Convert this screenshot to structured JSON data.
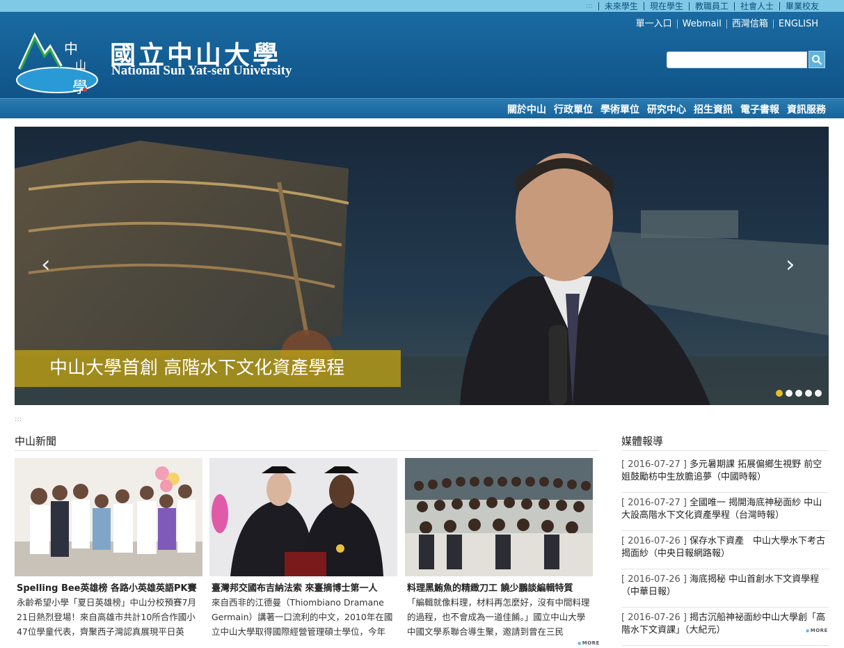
{
  "topbar": {
    "accesskey": ":::",
    "links": [
      "未來學生",
      "現在學生",
      "教職員工",
      "社會人士",
      "畢業校友"
    ]
  },
  "header": {
    "title_zh": "國立中山大學",
    "title_en": "National Sun Yat-sen University",
    "links": [
      "單一入口",
      "Webmail",
      "西灣信箱",
      "ENGLISH"
    ],
    "search": {
      "value": "",
      "placeholder": ""
    }
  },
  "nav": {
    "items": [
      "關於中山",
      "行政單位",
      "學術單位",
      "研究中心",
      "招生資訊",
      "電子書報",
      "資訊服務"
    ]
  },
  "banner": {
    "caption": "中山大學首創  高階水下文化資產學程",
    "slides": 5,
    "active_slide": 1,
    "prev": "‹",
    "next": "›"
  },
  "skip": ":::",
  "news": {
    "heading": "中山新聞",
    "more": "MORE",
    "items": [
      {
        "title": "Spelling Bee英雄榜 各路小英雄英語PK賽",
        "summary": "永齡希望小學「夏日英雄榜」中山分校預賽7月21日熱烈登場！來自高雄市共計10所合作國小47位學童代表，齊聚西子灣認真展現平日英"
      },
      {
        "title": "臺灣邦交國布吉納法索 來臺摘博士第一人",
        "summary": "來自西非的江德曼（Thiombiano Dramane Germain）講著一口流利的中文，2010年在國立中山大學取得國際經營管理碩士學位，今年"
      },
      {
        "title": "料理黑鮪魚的精緻刀工 饒少鵬談編輯特質",
        "summary": "「編輯就像料理，材料再怎麼好，沒有中間料理的過程，也不會成為一道佳餚。」國立中山大學中國文學系聯合導生聚，邀請到曾在三民"
      }
    ]
  },
  "media": {
    "heading": "媒體報導",
    "more": "MORE",
    "items": [
      {
        "date": "[ 2016-07-27 ]",
        "text": "多元暑期課 拓展偏鄉生視野 前空姐鼓勵枋中生放膽追夢（中國時報）"
      },
      {
        "date": "[ 2016-07-27 ]",
        "text": "全國唯一 揭開海底神秘面紗 中山大設高階水下文化資產學程（台灣時報）"
      },
      {
        "date": "[ 2016-07-26 ]",
        "text": "保存水下資產　中山大學水下考古揭面紗（中央日報網路報）"
      },
      {
        "date": "[ 2016-07-26 ]",
        "text": "海底揭秘 中山首創水下文資學程（中華日報）"
      },
      {
        "date": "[ 2016-07-26 ]",
        "text": "揭古沉船神祕面紗中山大學創「高階水下文資課」（大紀元）"
      }
    ]
  },
  "colors": {
    "topbar": "#7fc8e6",
    "header": "#1563a0",
    "caption": "#bea014",
    "accent": "#5fb4de"
  }
}
